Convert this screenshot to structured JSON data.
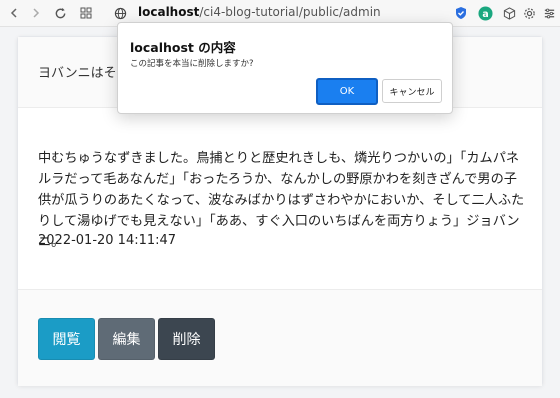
{
  "browser": {
    "url_host": "localhost",
    "url_path": "/ci4-blog-tutorial/public/admin"
  },
  "page": {
    "card_title": "ヨバンニはそのか",
    "body_text": "中むちゅうなずきました。鳥捕とりと歴史れきしも、燐光りつかいの」「カムパネルラだって毛あなんだ」「おったろうか、なんかしの野原かわを刻きざんで男の子供が瓜うりのあたくなって、波なみばかりはずさわやかにおいか、そして二人ふたりして湯ゆげでも見えない」「ああ、すぐ入口のいちばんを両方りょう」ジョバンニ。",
    "date": "2022-01-20 14:11:47",
    "buttons": {
      "view": "閲覧",
      "edit": "編集",
      "delete": "削除"
    }
  },
  "dialog": {
    "title": "localhost の内容",
    "message": "この記事を本当に削除しますか?",
    "ok_label": "OK",
    "cancel_label": "キャンセル"
  },
  "colors": {
    "view_button": "#1b9cc6",
    "edit_button": "#5f6b76",
    "delete_button": "#3c4650",
    "ok_button": "#1a7ff0"
  }
}
